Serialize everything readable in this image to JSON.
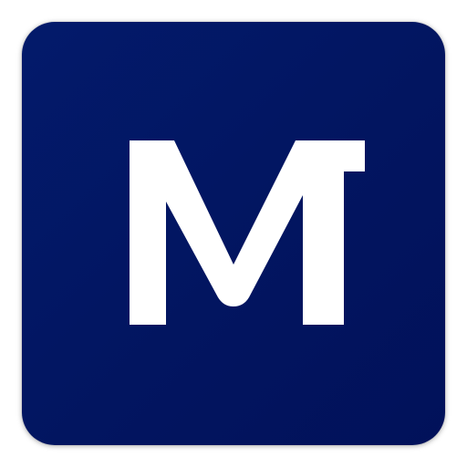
{
  "app_icon": {
    "name": "M",
    "logo_letter": "M",
    "background_color": "#021560",
    "glyph_color": "#ffffff"
  }
}
